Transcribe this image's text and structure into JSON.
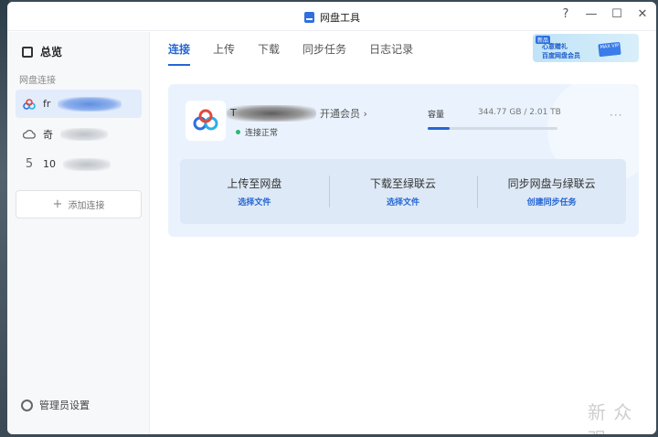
{
  "window": {
    "title": "网盘工具",
    "controls": {
      "help": "?",
      "minimize": "—",
      "maximize": "☐",
      "close": "✕"
    }
  },
  "sidebar": {
    "overview": "总览",
    "section_label": "网盘连接",
    "connections": [
      {
        "label": "fr",
        "icon": "baidu-cloud-icon",
        "active": true
      },
      {
        "label": "奇",
        "icon": "cloud-icon",
        "active": false
      },
      {
        "label": "10",
        "icon": "s-icon",
        "active": false
      }
    ],
    "add_connection": "添加连接",
    "admin_settings": "管理员设置"
  },
  "tabs": [
    {
      "label": "连接",
      "active": true
    },
    {
      "label": "上传",
      "active": false
    },
    {
      "label": "下载",
      "active": false
    },
    {
      "label": "同步任务",
      "active": false
    },
    {
      "label": "日志记录",
      "active": false
    }
  ],
  "promo": {
    "tag": "新品",
    "line1": "心意赠礼",
    "line2": "百度网盘会员",
    "card_text": "MAX VIP"
  },
  "account": {
    "name_prefix": "T",
    "open_vip": "开通会员 ›",
    "status": "连接正常",
    "status_color": "#2bb673"
  },
  "capacity": {
    "label": "容量",
    "value_text": "344.77 GB / 2.01 TB",
    "used_fraction": 0.17
  },
  "more": "···",
  "actions": [
    {
      "title": "上传至网盘",
      "link": "选择文件"
    },
    {
      "title": "下载至绿联云",
      "link": "选择文件"
    },
    {
      "title": "同步网盘与绿联云",
      "link": "创建同步任务"
    }
  ],
  "watermark": "新 众 观",
  "colors": {
    "accent": "#2566d4",
    "card_bg": "#eaf3fd"
  }
}
